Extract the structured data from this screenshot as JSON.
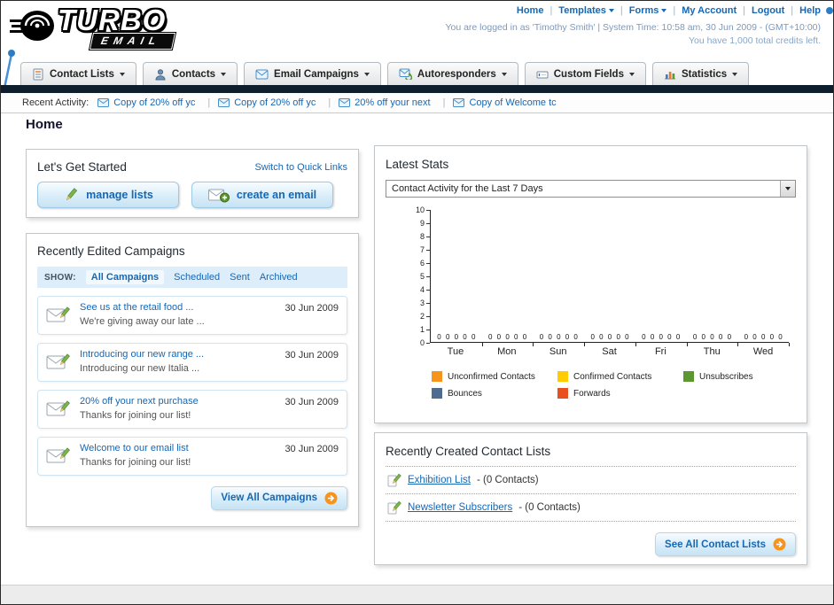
{
  "header": {
    "top_links": [
      {
        "label": "Home"
      },
      {
        "label": "Templates"
      },
      {
        "label": "Forms"
      },
      {
        "label": "My Account"
      },
      {
        "label": "Logout"
      },
      {
        "label": "Help"
      }
    ],
    "login_info": "You are logged in as 'Timothy Smith' | System Time: 10:58 am, 30 Jun 2009 - (GMT+10:00)",
    "credits_info": "You have 1,000 total credits left.",
    "logo_main": "TURBO",
    "logo_sub": "EMAIL"
  },
  "main_nav": {
    "items": [
      {
        "label": "Contact Lists"
      },
      {
        "label": "Contacts"
      },
      {
        "label": "Email Campaigns"
      },
      {
        "label": "Autoresponders"
      },
      {
        "label": "Custom Fields"
      },
      {
        "label": "Statistics"
      }
    ]
  },
  "recent_activity": {
    "label": "Recent Activity:",
    "items": [
      "Copy of 20% off yc",
      "Copy of 20% off yc",
      "20% off your next",
      "Copy of Welcome tc"
    ]
  },
  "page": {
    "title": "Home"
  },
  "get_started": {
    "title": "Let's Get Started",
    "switch_link": "Switch to Quick Links",
    "manage_lists_button": "manage lists",
    "create_email_button": "create an email"
  },
  "campaigns": {
    "title": "Recently Edited Campaigns",
    "show_label": "SHOW:",
    "filters": [
      "All Campaigns",
      "Scheduled",
      "Sent",
      "Archived"
    ],
    "items": [
      {
        "title": "See us at the retail food ...",
        "subtitle": "We're giving away our late ...",
        "date": "30 Jun 2009"
      },
      {
        "title": "Introducing our new range ...",
        "subtitle": "Introducing our new Italia ...",
        "date": "30 Jun 2009"
      },
      {
        "title": "20% off your next purchase",
        "subtitle": "Thanks for joining our list!",
        "date": "30 Jun 2009"
      },
      {
        "title": "Welcome to our email list",
        "subtitle": "Thanks for joining our list!",
        "date": "30 Jun 2009"
      }
    ],
    "view_all_button": "View All Campaigns"
  },
  "stats": {
    "title": "Latest Stats",
    "dropdown_value": "Contact Activity for the Last 7 Days",
    "chart_data": {
      "type": "bar",
      "title": "Contact Activity for the Last 7 Days",
      "categories": [
        "Tue",
        "Mon",
        "Sun",
        "Sat",
        "Fri",
        "Thu",
        "Wed"
      ],
      "series": [
        {
          "name": "Unconfirmed Contacts",
          "color": "#f7941e",
          "values": [
            0,
            0,
            0,
            0,
            0,
            0,
            0
          ]
        },
        {
          "name": "Confirmed Contacts",
          "color": "#ffcc00",
          "values": [
            0,
            0,
            0,
            0,
            0,
            0,
            0
          ]
        },
        {
          "name": "Unsubscribes",
          "color": "#5c9732",
          "values": [
            0,
            0,
            0,
            0,
            0,
            0,
            0
          ]
        },
        {
          "name": "Bounces",
          "color": "#4f6b91",
          "values": [
            0,
            0,
            0,
            0,
            0,
            0,
            0
          ]
        },
        {
          "name": "Forwards",
          "color": "#e8501e",
          "values": [
            0,
            0,
            0,
            0,
            0,
            0,
            0
          ]
        }
      ],
      "ylim": [
        0,
        10
      ],
      "yticks": [
        0,
        1,
        2,
        3,
        4,
        5,
        6,
        7,
        8,
        9,
        10
      ],
      "legend_position": "bottom",
      "grid": false
    }
  },
  "contact_lists": {
    "title": "Recently Created Contact Lists",
    "items": [
      {
        "name": "Exhibition List",
        "suffix": "- (0 Contacts)"
      },
      {
        "name": "Newsletter Subscribers",
        "suffix": "- (0 Contacts)"
      }
    ],
    "see_all_button": "See All Contact Lists"
  }
}
